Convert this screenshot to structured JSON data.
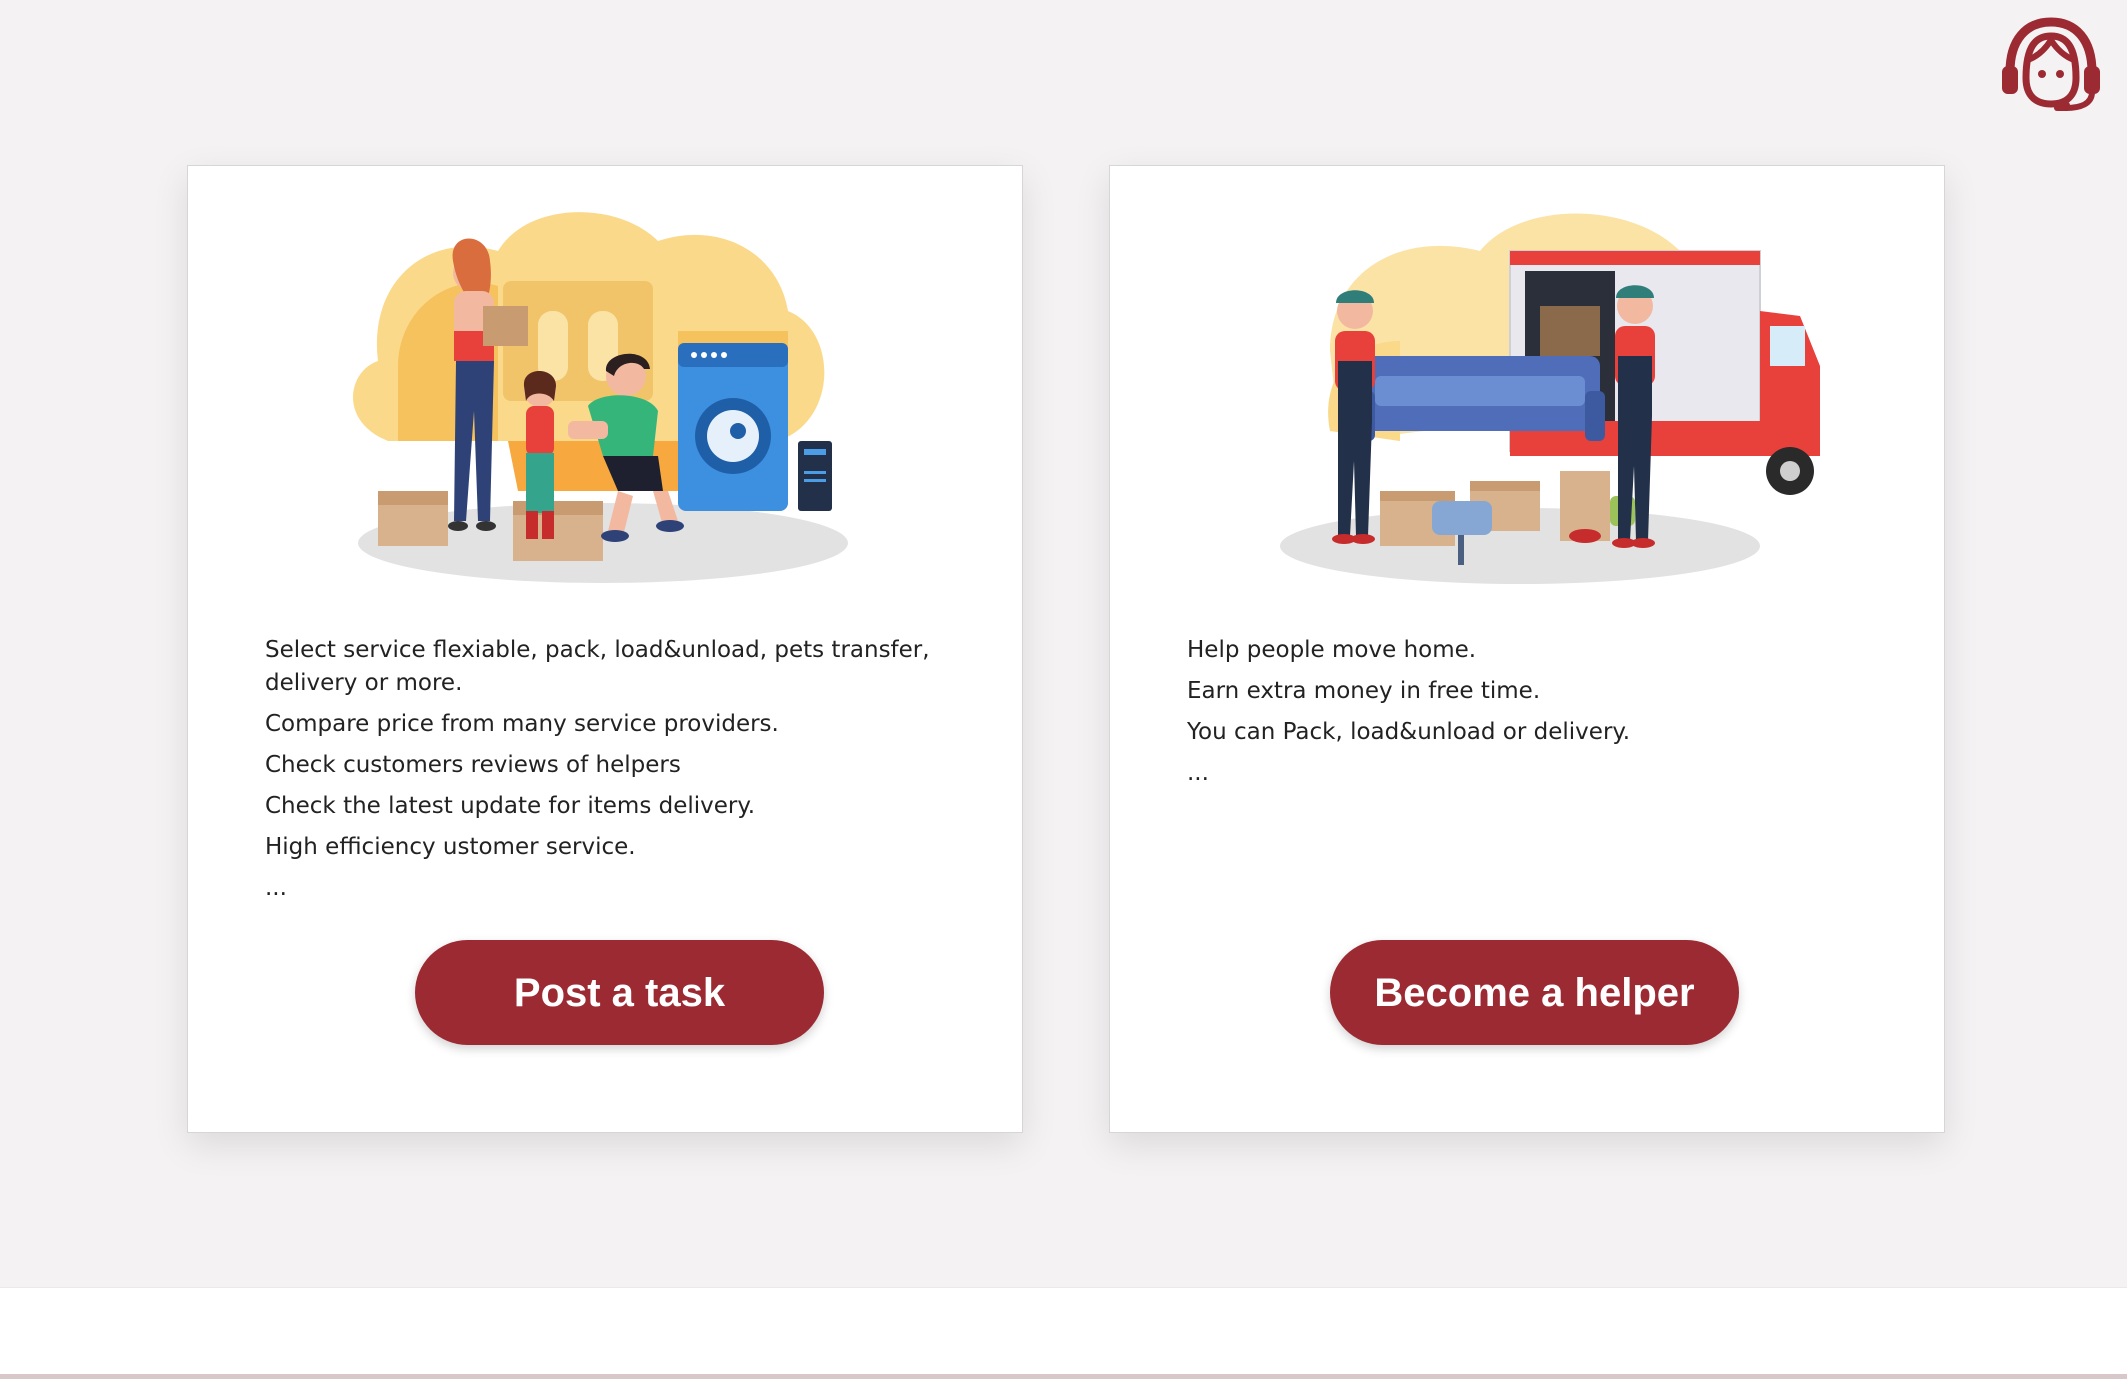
{
  "support": {
    "icon": "support-agent-icon"
  },
  "cards": [
    {
      "illustration": "family-moving-illustration",
      "lines": [
        "Select service flexiable, pack, load&unload, pets transfer, delivery or more.",
        "Compare price from many service providers.",
        "Check customers reviews of helpers",
        "Check the latest update for items delivery.",
        "High efficiency ustomer service.",
        "..."
      ],
      "button_label": "Post a task"
    },
    {
      "illustration": "movers-truck-illustration",
      "lines": [
        "Help people move home.",
        "Earn extra money in free time.",
        "You can Pack, load&unload or delivery.",
        "..."
      ],
      "button_label": "Become a helper"
    }
  ],
  "colors": {
    "accent": "#9c2a33",
    "background": "#f4f2f3",
    "card": "#ffffff"
  }
}
